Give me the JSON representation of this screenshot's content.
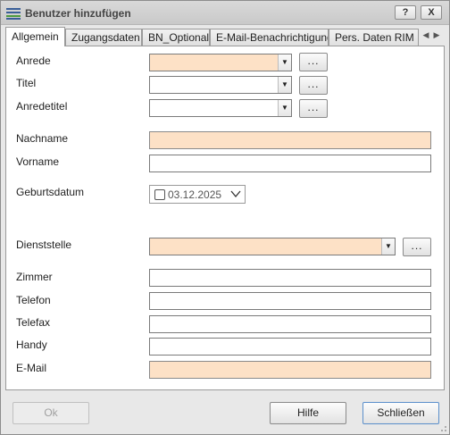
{
  "window": {
    "title": "Benutzer hinzufügen",
    "help_button": "?",
    "close_button": "X"
  },
  "tabs": [
    {
      "label": "Allgemein",
      "active": true
    },
    {
      "label": "Zugangsdaten",
      "active": false
    },
    {
      "label": "BN_Optional",
      "active": false
    },
    {
      "label": "E-Mail-Benachrichtigung",
      "active": false
    },
    {
      "label": "Pers. Daten RIM",
      "active": false
    }
  ],
  "form": {
    "anrede": {
      "label": "Anrede",
      "value": "",
      "required": true
    },
    "titel": {
      "label": "Titel",
      "value": ""
    },
    "anredetitel": {
      "label": "Anredetitel",
      "value": ""
    },
    "nachname": {
      "label": "Nachname",
      "value": "",
      "required": true
    },
    "vorname": {
      "label": "Vorname",
      "value": ""
    },
    "geburtsdatum": {
      "label": "Geburtsdatum",
      "value": "03.12.2025",
      "checked": false
    },
    "dienststelle": {
      "label": "Dienststelle",
      "value": "",
      "required": true
    },
    "zimmer": {
      "label": "Zimmer",
      "value": ""
    },
    "telefon": {
      "label": "Telefon",
      "value": ""
    },
    "telefax": {
      "label": "Telefax",
      "value": ""
    },
    "handy": {
      "label": "Handy",
      "value": ""
    },
    "email": {
      "label": "E-Mail",
      "value": "",
      "required": true
    },
    "browse_label": "..."
  },
  "footer": {
    "ok_label": "Ok",
    "hilfe_label": "Hilfe",
    "schliessen_label": "Schließen"
  },
  "colors": {
    "required_field": "#fde1c6",
    "focus_border": "#5b8fcb"
  },
  "icons": {
    "app": "list-icon",
    "dropdown": "chevron-down-icon",
    "tab_scroll_left": "triangle-left-icon",
    "tab_scroll_right": "triangle-right-icon"
  }
}
